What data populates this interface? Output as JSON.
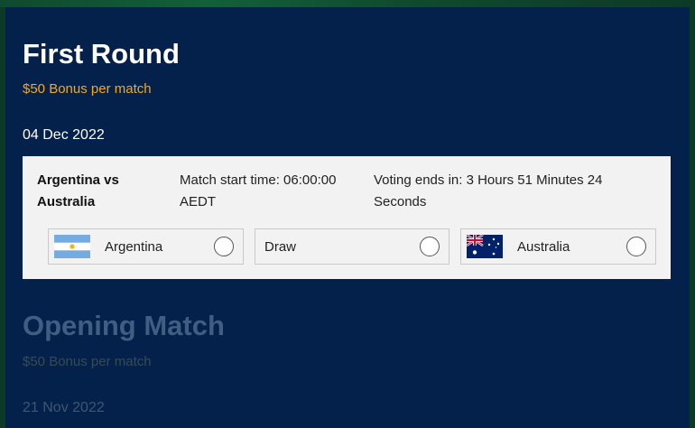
{
  "first_round": {
    "title": "First Round",
    "bonus": "$50 Bonus per match",
    "date": "04 Dec 2022",
    "match": {
      "teams_line1": "Argentina vs",
      "teams_line2": "Australia",
      "start_line1": "Match start time: 06:00:00",
      "start_line2": "AEDT",
      "voting_line1": "Voting ends in: 3 Hours 51 Minutes 24",
      "voting_line2": "Seconds",
      "options": [
        {
          "label": "Argentina",
          "flag": "argentina-flag-icon"
        },
        {
          "label": "Draw",
          "flag": null
        },
        {
          "label": "Australia",
          "flag": "australia-flag-icon"
        }
      ]
    }
  },
  "opening_match": {
    "title": "Opening Match",
    "bonus": "$50 Bonus per match",
    "date": "21 Nov 2022"
  },
  "colors": {
    "panel_bg": "#03214a",
    "accent_orange": "#f5a623",
    "card_bg": "#f2f2f2"
  }
}
